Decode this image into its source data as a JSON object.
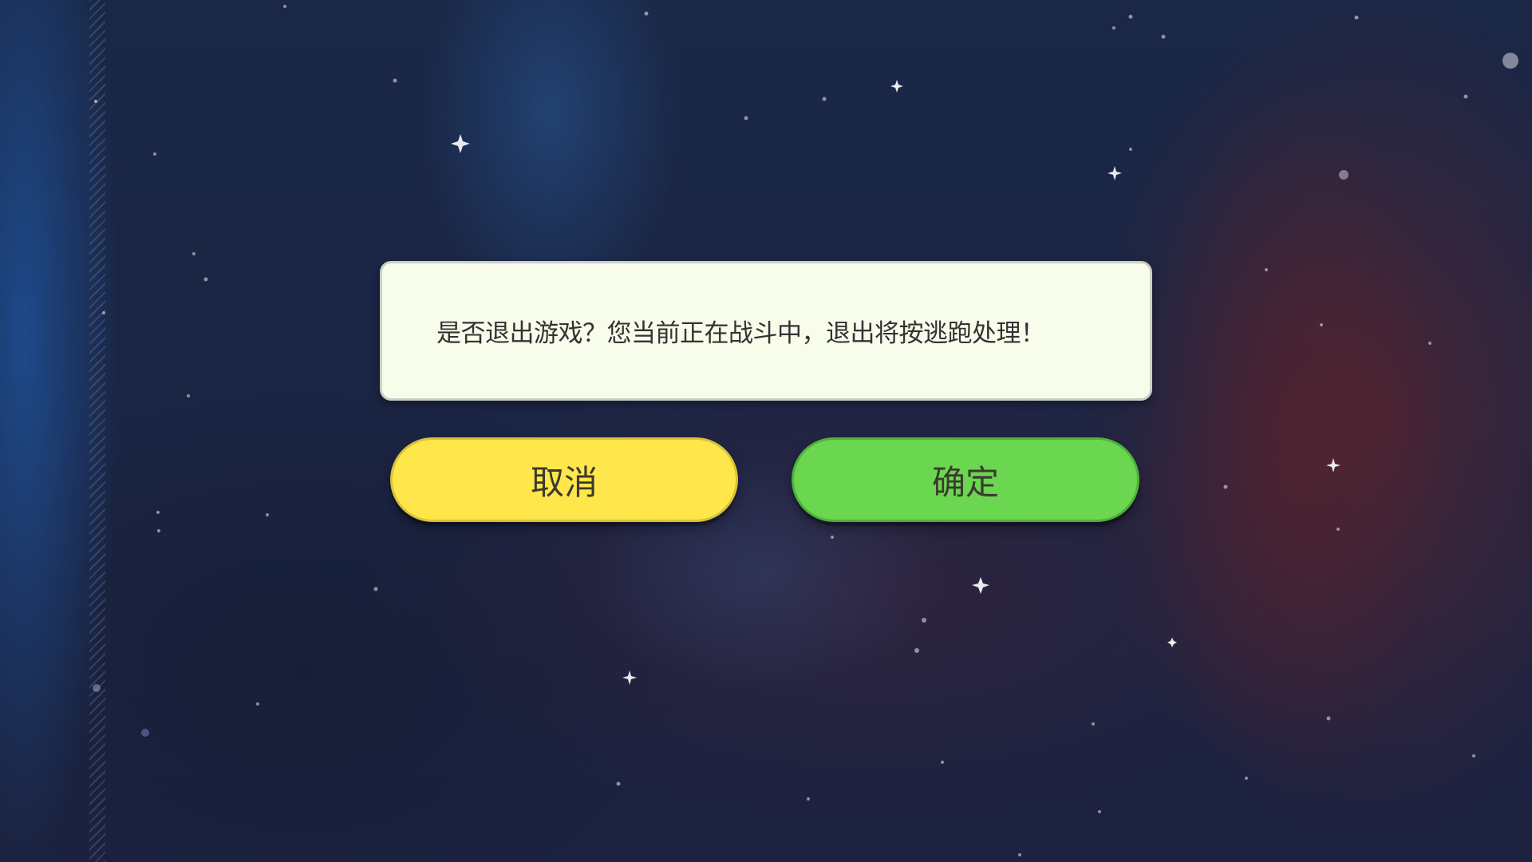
{
  "dialog": {
    "message": "是否退出游戏？您当前正在战斗中，退出将按逃跑处理！"
  },
  "buttons": {
    "cancel_label": "取消",
    "confirm_label": "确定"
  },
  "colors": {
    "dialog_background": "#f7fdea",
    "cancel_button": "#ffe64a",
    "confirm_button": "#6bd64f",
    "space_background": "#1b2544"
  }
}
